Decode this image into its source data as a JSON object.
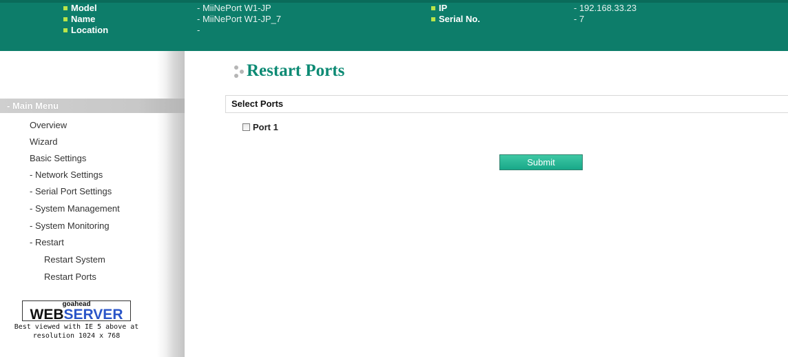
{
  "header": {
    "model_label": "Model",
    "model_value": "- MiiNePort W1-JP",
    "name_label": "Name",
    "name_value": "- MiiNePort W1-JP_7",
    "location_label": "Location",
    "location_value": "-",
    "ip_label": "IP",
    "ip_value": "- 192.168.33.23",
    "serial_label": "Serial No.",
    "serial_value": "- 7"
  },
  "sidebar": {
    "menu_title": "- Main Menu",
    "items": [
      {
        "label": "Overview"
      },
      {
        "label": "Wizard"
      },
      {
        "label": "Basic Settings"
      },
      {
        "label": "- Network Settings"
      },
      {
        "label": "- Serial Port Settings"
      },
      {
        "label": "- System Management"
      },
      {
        "label": "- System Monitoring"
      },
      {
        "label": "- Restart"
      },
      {
        "label": "Restart System"
      },
      {
        "label": "Restart Ports"
      }
    ],
    "logo": {
      "small": "goahead",
      "web": "WEB",
      "server": "SERVER",
      "caption_line1": "Best viewed with IE 5 above at",
      "caption_line2": "resolution 1024 x 768"
    }
  },
  "main": {
    "title": "Restart Ports",
    "section_title": "Select Ports",
    "port_label": "Port 1",
    "port_checked": false,
    "submit_label": "Submit"
  },
  "colors": {
    "header_bg": "#0d7d6a",
    "title_color": "#0d8a74",
    "bullet": "#b9e44a",
    "button": "#18a889"
  }
}
